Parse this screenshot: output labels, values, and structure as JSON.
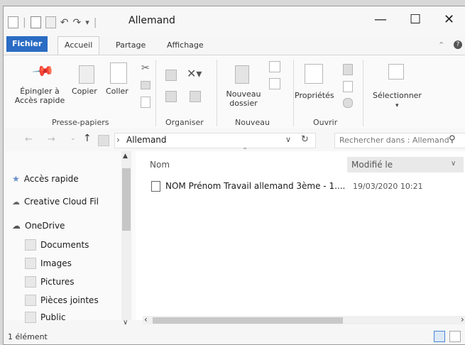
{
  "window": {
    "title": "Allemand",
    "minimize": "—",
    "maximize": "☐",
    "close": "✕"
  },
  "tabs": {
    "file": "Fichier",
    "home": "Accueil",
    "share": "Partage",
    "view": "Affichage"
  },
  "ribbon": {
    "pin_line1": "Épingler à",
    "pin_line2": "Accès rapide",
    "copy": "Copier",
    "paste": "Coller",
    "group_clipboard": "Presse-papiers",
    "group_organize": "Organiser",
    "new_folder_line1": "Nouveau",
    "new_folder_line2": "dossier",
    "group_new": "Nouveau",
    "properties": "Propriétés",
    "group_open": "Ouvrir",
    "select": "Sélectionner"
  },
  "address": {
    "path": "Allemand",
    "search_placeholder": "Rechercher dans : Allemand"
  },
  "nav": {
    "quick_access": "Accès rapide",
    "creative_cloud": "Creative Cloud Fil",
    "onedrive": "OneDrive",
    "folders": [
      "Documents",
      "Images",
      "Pictures",
      "Pièces jointes",
      "Public"
    ]
  },
  "columns": {
    "name": "Nom",
    "modified": "Modifié le"
  },
  "files": [
    {
      "name": "NOM Prénom Travail allemand 3ème - 1....",
      "modified": "19/03/2020 10:21"
    }
  ],
  "status": {
    "count": "1 élément"
  }
}
